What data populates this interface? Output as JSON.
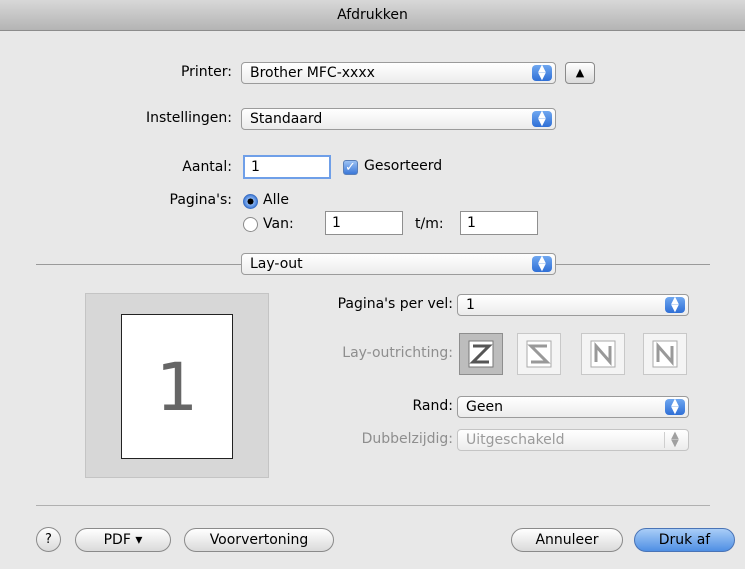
{
  "window": {
    "title": "Afdrukken"
  },
  "printer": {
    "label": "Printer:",
    "value": "Brother MFC-xxxx"
  },
  "presets": {
    "label": "Instellingen:",
    "value": "Standaard"
  },
  "copies": {
    "label": "Aantal:",
    "value": "1",
    "collated_label": "Gesorteerd",
    "collated": true
  },
  "pages": {
    "label": "Pagina's:",
    "all_label": "Alle",
    "from_label": "Van:",
    "from_value": "1",
    "to_label": "t/m:",
    "to_value": "1",
    "selected": "all"
  },
  "section": {
    "value": "Lay-out"
  },
  "layout": {
    "preview_page_number": "1",
    "pages_per_sheet": {
      "label": "Pagina's per vel:",
      "value": "1"
    },
    "direction": {
      "label": "Lay-outrichting:",
      "icons": [
        "z-direction-icon",
        "reverse-s-direction-icon",
        "reverse-n-direction-icon",
        "n-direction-icon"
      ],
      "selected_index": 0
    },
    "border": {
      "label": "Rand:",
      "value": "Geen"
    },
    "two_sided": {
      "label": "Dubbelzijdig:",
      "value": "Uitgeschakeld",
      "enabled": false
    }
  },
  "footer": {
    "help_label": "?",
    "pdf_label": "PDF ▾",
    "preview_label": "Voorvertoning",
    "cancel_label": "Annuleer",
    "print_label": "Druk af"
  },
  "colors": {
    "accent": "#3b78d8",
    "default_button": "#4f8fe4",
    "disabled_text": "#8e8e8e"
  }
}
